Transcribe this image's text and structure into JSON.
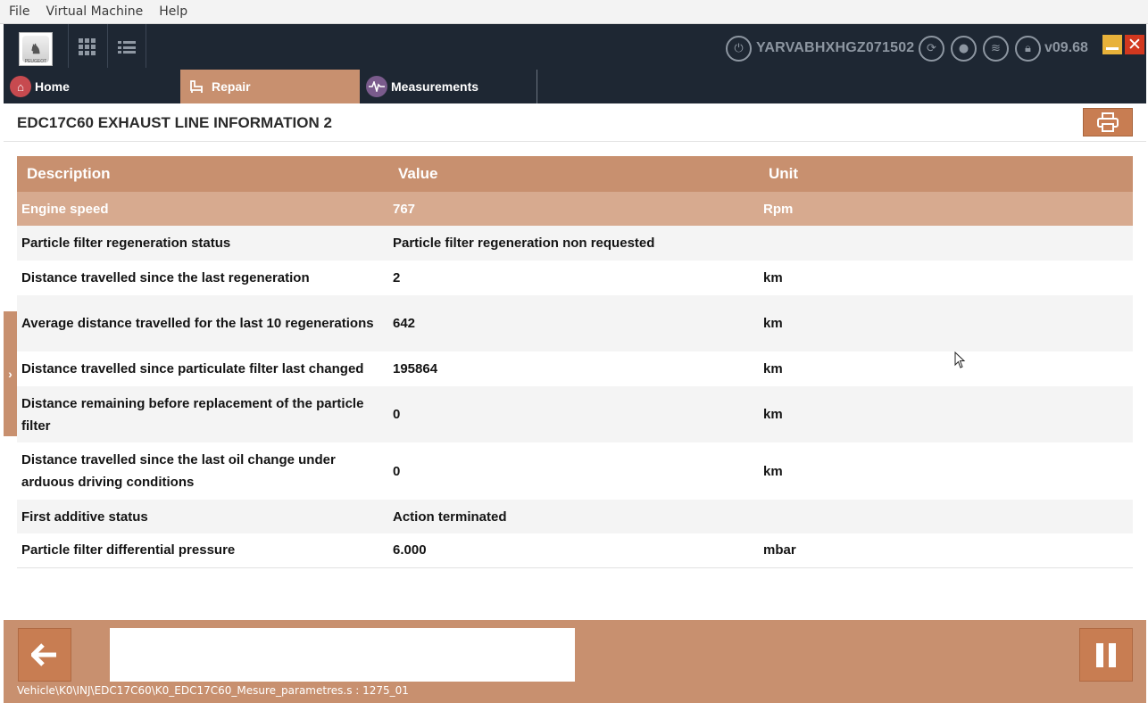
{
  "vm_menu": [
    "File",
    "Virtual Machine",
    "Help"
  ],
  "header": {
    "logo_text": "PEUGEOT",
    "vin": "YARVABHXHGZ071502",
    "version": "v09.68"
  },
  "tabs": [
    {
      "label": "Home"
    },
    {
      "label": "Repair"
    },
    {
      "label": "Measurements"
    }
  ],
  "page": {
    "title": "EDC17C60 EXHAUST LINE INFORMATION 2"
  },
  "table": {
    "headers": [
      "Description",
      "Value",
      "Unit"
    ],
    "rows": [
      {
        "description": "Engine speed",
        "value": "767",
        "unit": "Rpm"
      },
      {
        "description": "Particle filter regeneration status",
        "value": "Particle filter regeneration non requested",
        "unit": ""
      },
      {
        "description": "Distance travelled since the last regeneration",
        "value": "2",
        "unit": "km"
      },
      {
        "description": "Average distance travelled for the last 10 regenerations",
        "value": "642",
        "unit": "km"
      },
      {
        "description": "Distance travelled since particulate filter last changed",
        "value": "195864",
        "unit": "km"
      },
      {
        "description": "Distance remaining before replacement of the particle filter",
        "value": "0",
        "unit": "km"
      },
      {
        "description": "Distance travelled since the last oil change under arduous driving conditions",
        "value": "0",
        "unit": "km"
      },
      {
        "description": "First additive status",
        "value": "Action terminated",
        "unit": ""
      },
      {
        "description": "Particle filter differential pressure",
        "value": "6.000",
        "unit": "mbar"
      }
    ]
  },
  "footer": {
    "status_path": "Vehicle\\K0\\INJ\\EDC17C60\\K0_EDC17C60_Mesure_parametres.s : 1275_01"
  },
  "colors": {
    "accent": "#c8906f",
    "header_bg": "#1e2733",
    "selected_row": "#d7aa8f"
  }
}
